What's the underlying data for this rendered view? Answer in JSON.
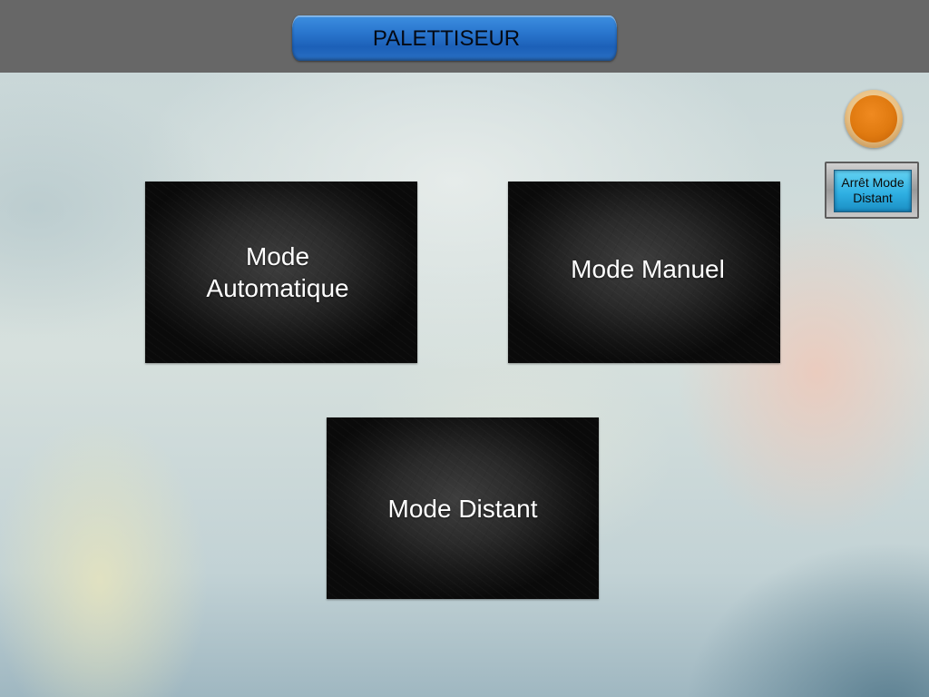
{
  "header": {
    "title": "PALETTISEUR"
  },
  "status": {
    "indicator_color": "#e07a10"
  },
  "controls": {
    "stop_remote_label": "Arrêt Mode\nDistant"
  },
  "modes": {
    "automatic_label": "Mode\nAutomatique",
    "manual_label": "Mode Manuel",
    "remote_label": "Mode Distant"
  },
  "colors": {
    "header_bg": "#676767",
    "title_plate": "#2b78cf",
    "stop_button": "#2fb0e3",
    "tile_bg": "#1a1a1a"
  }
}
